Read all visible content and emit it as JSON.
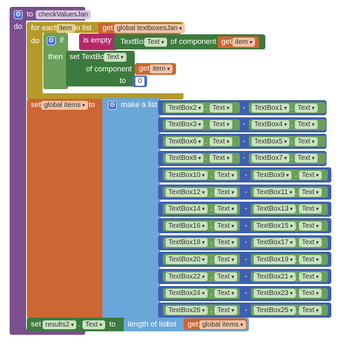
{
  "procedure": {
    "to_label": "to",
    "name": "checkValuesJan",
    "do_label": "do"
  },
  "foreach": {
    "label": "for each",
    "var": "item",
    "in_list_label": "in list",
    "get_label": "get",
    "list_var": "global textboxesJan",
    "do_label": "do"
  },
  "if_block": {
    "if_label": "if",
    "then_label": "then",
    "is_empty_label": "is empty",
    "textbox_label": "TextBox.",
    "prop": "Text",
    "of_component_label": "of component",
    "get_label": "get",
    "item_var": "item"
  },
  "set_textbox": {
    "label": "set TextBox.",
    "prop": "Text",
    "of_component_label": "of component",
    "get_label": "get",
    "item_var": "item",
    "to_label": "to",
    "value": "0"
  },
  "set_items": {
    "set_label": "set",
    "var": "global items",
    "to_label": "to",
    "make_list_label": "make a list"
  },
  "rows": [
    {
      "left": "TextBox2",
      "right": "TextBox1"
    },
    {
      "left": "TextBox3",
      "right": "TextBox4"
    },
    {
      "left": "TextBox6",
      "right": "TextBox5"
    },
    {
      "left": "TextBox8",
      "right": "TextBox7"
    },
    {
      "left": "TextBox10",
      "right": "TextBox9"
    },
    {
      "left": "TextBox12",
      "right": "TextBox11"
    },
    {
      "left": "TextBox14",
      "right": "TextBox13"
    },
    {
      "left": "TextBox16",
      "right": "TextBox15"
    },
    {
      "left": "TextBox18",
      "right": "TextBox17"
    },
    {
      "left": "TextBox20",
      "right": "TextBox19"
    },
    {
      "left": "TextBox22",
      "right": "TextBox21"
    },
    {
      "left": "TextBox24",
      "right": "TextBox23"
    },
    {
      "left": "TextBox26",
      "right": "TextBox25"
    }
  ],
  "row_prop": "Text",
  "row_op": "-",
  "set_results": {
    "set_label": "set",
    "component": "results2",
    "prop": "Text",
    "to_label": "to",
    "length_label": "length of list",
    "list_label": "list",
    "get_label": "get",
    "var": "global items"
  },
  "colors": {
    "procedure": "#7b4f8f",
    "control": "#b59a2b",
    "logic": "#6aa05a",
    "variable": "#cc6633",
    "component": "#3d7a3d",
    "list": "#6aa7d8",
    "math": "#4a6fd0",
    "row_block": "#3f5fb0"
  }
}
